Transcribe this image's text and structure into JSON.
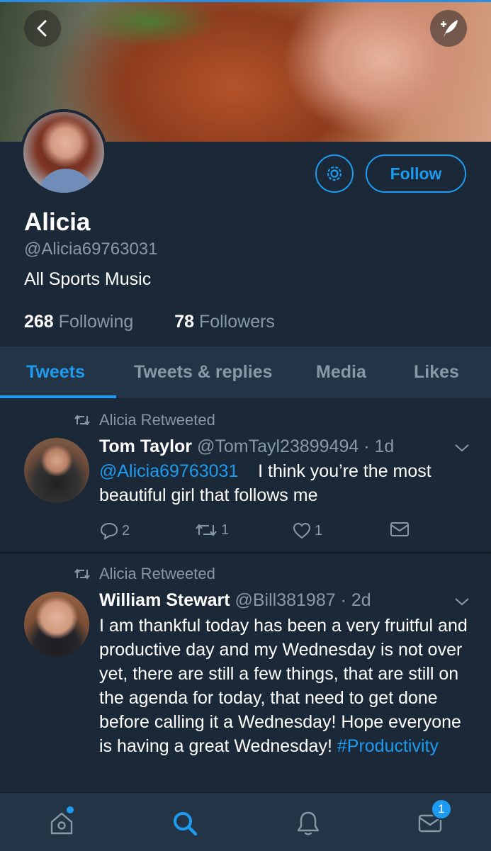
{
  "profile": {
    "name": "Alicia",
    "handle": "@Alicia69763031",
    "bio": "All Sports Music",
    "following_count": "268",
    "following_label": "Following",
    "followers_count": "78",
    "followers_label": "Followers",
    "follow_label": "Follow"
  },
  "tabs": [
    {
      "label": "Tweets",
      "active": true
    },
    {
      "label": "Tweets & replies",
      "active": false
    },
    {
      "label": "Media",
      "active": false
    },
    {
      "label": "Likes",
      "active": false
    }
  ],
  "tweets": [
    {
      "retweet_label": "Alicia Retweeted",
      "author_name": "Tom Taylor",
      "author_handle": "@TomTayl23899494",
      "time": "· 1d",
      "mention": "@Alicia69763031",
      "text": "I think you’re the most beautiful girl that follows me",
      "replies": "2",
      "retweets": "1",
      "likes": "1"
    },
    {
      "retweet_label": "Alicia Retweeted",
      "author_name": "William Stewart",
      "author_handle": "@Bill381987",
      "time": "· 2d",
      "text": "I am thankful today has been a very fruitful and productive day and my Wednesday is not over yet, there are still a few things, that are still on the agenda for today, that need to get done before calling it a Wednesday! Hope everyone is having a great Wednesday!",
      "hashtag": "#Productivity"
    }
  ],
  "nav": {
    "messages_badge": "1"
  },
  "colors": {
    "background": "#1b2837",
    "accent": "#1d9bf0",
    "muted": "#8899a6",
    "bar": "#243447"
  }
}
